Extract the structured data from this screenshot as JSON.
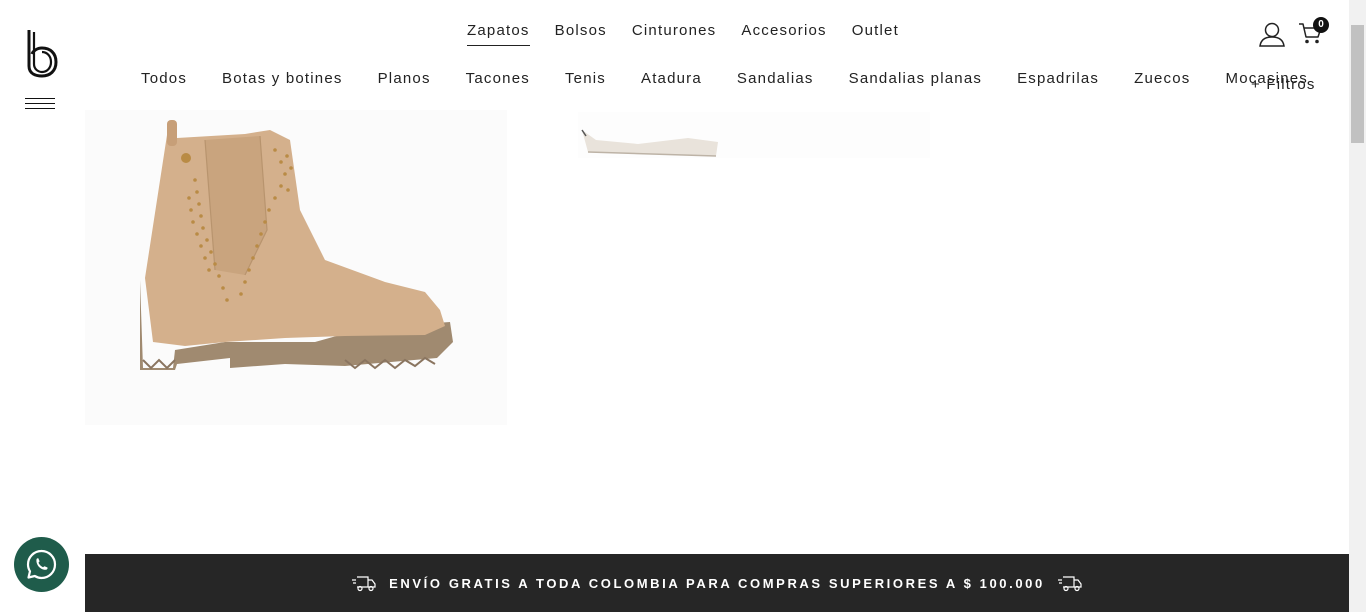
{
  "header": {
    "main_nav": [
      {
        "label": "Zapatos",
        "active": true
      },
      {
        "label": "Bolsos"
      },
      {
        "label": "Cinturones"
      },
      {
        "label": "Accesorios"
      },
      {
        "label": "Outlet"
      }
    ],
    "sub_nav": [
      "Todos",
      "Botas y botines",
      "Planos",
      "Tacones",
      "Tenis",
      "Atadura",
      "Sandalias",
      "Sandalias planas",
      "Espadrilas",
      "Zuecos",
      "Mocasines"
    ],
    "filters_label": "+ Filtros",
    "cart_count": "0",
    "icons": {
      "user": "user-icon",
      "cart": "cart-icon",
      "menu": "hamburger-menu-icon",
      "logo": "brand-logo"
    }
  },
  "footer": {
    "banner_text": "ENVÍO GRATIS A TODA COLOMBIA PARA COMPRAS SUPERIORES A $ 100.000",
    "icon": "delivery-truck-icon"
  },
  "colors": {
    "footer_bg": "#262626",
    "whatsapp_bg": "#1f5c4b",
    "boot_color": "#d4b08c",
    "sole_color": "#a08a70"
  }
}
